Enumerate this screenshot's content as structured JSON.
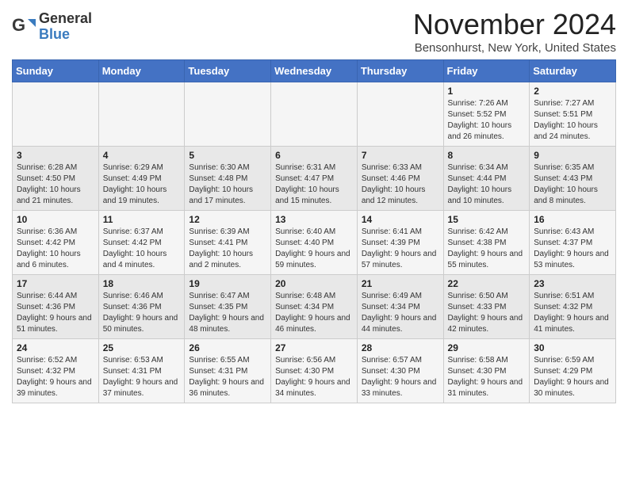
{
  "header": {
    "logo_general": "General",
    "logo_blue": "Blue",
    "month_title": "November 2024",
    "location": "Bensonhurst, New York, United States"
  },
  "days_of_week": [
    "Sunday",
    "Monday",
    "Tuesday",
    "Wednesday",
    "Thursday",
    "Friday",
    "Saturday"
  ],
  "weeks": [
    [
      {
        "day": "",
        "info": ""
      },
      {
        "day": "",
        "info": ""
      },
      {
        "day": "",
        "info": ""
      },
      {
        "day": "",
        "info": ""
      },
      {
        "day": "",
        "info": ""
      },
      {
        "day": "1",
        "info": "Sunrise: 7:26 AM\nSunset: 5:52 PM\nDaylight: 10 hours and 26 minutes."
      },
      {
        "day": "2",
        "info": "Sunrise: 7:27 AM\nSunset: 5:51 PM\nDaylight: 10 hours and 24 minutes."
      }
    ],
    [
      {
        "day": "3",
        "info": "Sunrise: 6:28 AM\nSunset: 4:50 PM\nDaylight: 10 hours and 21 minutes."
      },
      {
        "day": "4",
        "info": "Sunrise: 6:29 AM\nSunset: 4:49 PM\nDaylight: 10 hours and 19 minutes."
      },
      {
        "day": "5",
        "info": "Sunrise: 6:30 AM\nSunset: 4:48 PM\nDaylight: 10 hours and 17 minutes."
      },
      {
        "day": "6",
        "info": "Sunrise: 6:31 AM\nSunset: 4:47 PM\nDaylight: 10 hours and 15 minutes."
      },
      {
        "day": "7",
        "info": "Sunrise: 6:33 AM\nSunset: 4:46 PM\nDaylight: 10 hours and 12 minutes."
      },
      {
        "day": "8",
        "info": "Sunrise: 6:34 AM\nSunset: 4:44 PM\nDaylight: 10 hours and 10 minutes."
      },
      {
        "day": "9",
        "info": "Sunrise: 6:35 AM\nSunset: 4:43 PM\nDaylight: 10 hours and 8 minutes."
      }
    ],
    [
      {
        "day": "10",
        "info": "Sunrise: 6:36 AM\nSunset: 4:42 PM\nDaylight: 10 hours and 6 minutes."
      },
      {
        "day": "11",
        "info": "Sunrise: 6:37 AM\nSunset: 4:42 PM\nDaylight: 10 hours and 4 minutes."
      },
      {
        "day": "12",
        "info": "Sunrise: 6:39 AM\nSunset: 4:41 PM\nDaylight: 10 hours and 2 minutes."
      },
      {
        "day": "13",
        "info": "Sunrise: 6:40 AM\nSunset: 4:40 PM\nDaylight: 9 hours and 59 minutes."
      },
      {
        "day": "14",
        "info": "Sunrise: 6:41 AM\nSunset: 4:39 PM\nDaylight: 9 hours and 57 minutes."
      },
      {
        "day": "15",
        "info": "Sunrise: 6:42 AM\nSunset: 4:38 PM\nDaylight: 9 hours and 55 minutes."
      },
      {
        "day": "16",
        "info": "Sunrise: 6:43 AM\nSunset: 4:37 PM\nDaylight: 9 hours and 53 minutes."
      }
    ],
    [
      {
        "day": "17",
        "info": "Sunrise: 6:44 AM\nSunset: 4:36 PM\nDaylight: 9 hours and 51 minutes."
      },
      {
        "day": "18",
        "info": "Sunrise: 6:46 AM\nSunset: 4:36 PM\nDaylight: 9 hours and 50 minutes."
      },
      {
        "day": "19",
        "info": "Sunrise: 6:47 AM\nSunset: 4:35 PM\nDaylight: 9 hours and 48 minutes."
      },
      {
        "day": "20",
        "info": "Sunrise: 6:48 AM\nSunset: 4:34 PM\nDaylight: 9 hours and 46 minutes."
      },
      {
        "day": "21",
        "info": "Sunrise: 6:49 AM\nSunset: 4:34 PM\nDaylight: 9 hours and 44 minutes."
      },
      {
        "day": "22",
        "info": "Sunrise: 6:50 AM\nSunset: 4:33 PM\nDaylight: 9 hours and 42 minutes."
      },
      {
        "day": "23",
        "info": "Sunrise: 6:51 AM\nSunset: 4:32 PM\nDaylight: 9 hours and 41 minutes."
      }
    ],
    [
      {
        "day": "24",
        "info": "Sunrise: 6:52 AM\nSunset: 4:32 PM\nDaylight: 9 hours and 39 minutes."
      },
      {
        "day": "25",
        "info": "Sunrise: 6:53 AM\nSunset: 4:31 PM\nDaylight: 9 hours and 37 minutes."
      },
      {
        "day": "26",
        "info": "Sunrise: 6:55 AM\nSunset: 4:31 PM\nDaylight: 9 hours and 36 minutes."
      },
      {
        "day": "27",
        "info": "Sunrise: 6:56 AM\nSunset: 4:30 PM\nDaylight: 9 hours and 34 minutes."
      },
      {
        "day": "28",
        "info": "Sunrise: 6:57 AM\nSunset: 4:30 PM\nDaylight: 9 hours and 33 minutes."
      },
      {
        "day": "29",
        "info": "Sunrise: 6:58 AM\nSunset: 4:30 PM\nDaylight: 9 hours and 31 minutes."
      },
      {
        "day": "30",
        "info": "Sunrise: 6:59 AM\nSunset: 4:29 PM\nDaylight: 9 hours and 30 minutes."
      }
    ]
  ]
}
